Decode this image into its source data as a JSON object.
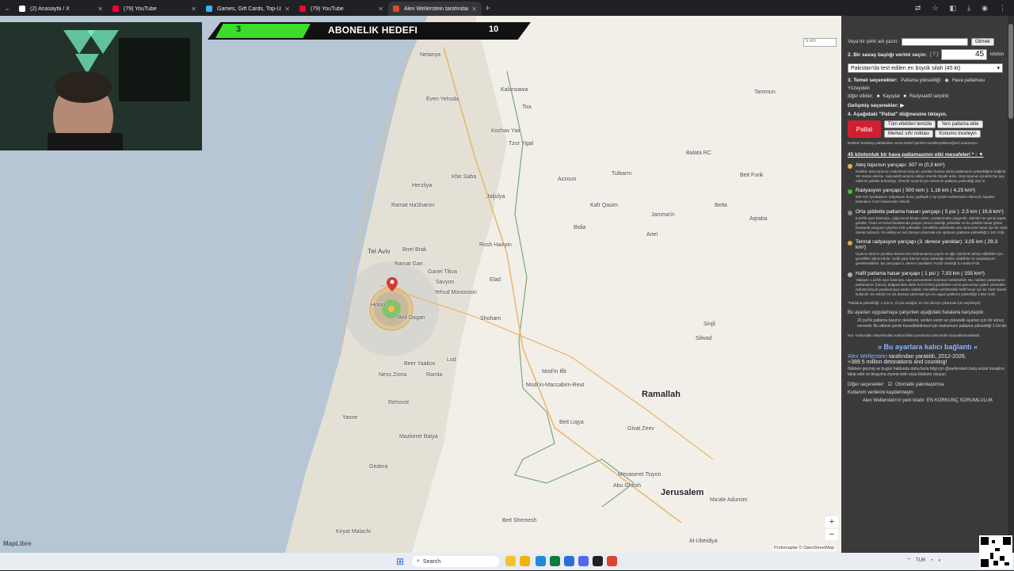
{
  "browser": {
    "tabs": [
      {
        "title": "(2) Anasayfa / X",
        "favicon_color": "#ffffff"
      },
      {
        "title": "(79) YouTube",
        "favicon_color": "#ff0033"
      },
      {
        "title": "Games, Gift Cards, Top-Ups & V",
        "favicon_color": "#3ab0ff"
      },
      {
        "title": "(79) YouTube",
        "favicon_color": "#ff0033"
      },
      {
        "title": "Alex Wellerstein tarafından hazı",
        "favicon_color": "#d94a2b"
      }
    ],
    "active_tab": 4
  },
  "overlay": {
    "current": "3",
    "label": "ABONELIK HEDEFI",
    "target": "10"
  },
  "map": {
    "scale_text": "5 km",
    "places": [
      {
        "name": "Netanya",
        "cls": ""
      },
      {
        "name": "Kalansawa",
        "cls": ""
      },
      {
        "name": "Even Yehuda",
        "cls": ""
      },
      {
        "name": "Tira",
        "cls": ""
      },
      {
        "name": "Kochav Yair",
        "cls": ""
      },
      {
        "name": "Tzur Yigal",
        "cls": ""
      },
      {
        "name": "Tulkarm",
        "cls": ""
      },
      {
        "name": "Tammun",
        "cls": ""
      },
      {
        "name": "Kfar Saba",
        "cls": ""
      },
      {
        "name": "Herzliya",
        "cls": ""
      },
      {
        "name": "Ramat HaSharon",
        "cls": ""
      },
      {
        "name": "Jaljulya",
        "cls": ""
      },
      {
        "name": "Azzoun",
        "cls": ""
      },
      {
        "name": "Balata RC",
        "cls": ""
      },
      {
        "name": "Beit Furik",
        "cls": ""
      },
      {
        "name": "Kafr Qasim",
        "cls": ""
      },
      {
        "name": "Beita",
        "cls": ""
      },
      {
        "name": "Jamma'in",
        "cls": ""
      },
      {
        "name": "Aqraba",
        "cls": ""
      },
      {
        "name": "Bidia",
        "cls": ""
      },
      {
        "name": "Ariel",
        "cls": ""
      },
      {
        "name": "Rosh HaAyin",
        "cls": ""
      },
      {
        "name": "Tel Aviv",
        "cls": "med"
      },
      {
        "name": "Bnei Brak",
        "cls": ""
      },
      {
        "name": "Ramat Gan",
        "cls": ""
      },
      {
        "name": "Ganei Tikva",
        "cls": ""
      },
      {
        "name": "Savyon",
        "cls": ""
      },
      {
        "name": "Yehud Monosson",
        "cls": ""
      },
      {
        "name": "Elad",
        "cls": ""
      },
      {
        "name": "Holon",
        "cls": ""
      },
      {
        "name": "Beit Dagan",
        "cls": ""
      },
      {
        "name": "Shoham",
        "cls": ""
      },
      {
        "name": "Beer Yaakov",
        "cls": ""
      },
      {
        "name": "Lod",
        "cls": ""
      },
      {
        "name": "Ness Ziona",
        "cls": ""
      },
      {
        "name": "Ramla",
        "cls": ""
      },
      {
        "name": "Rehovot",
        "cls": ""
      },
      {
        "name": "Mod'in Illit",
        "cls": ""
      },
      {
        "name": "Modi'in-Maccabim-Reut",
        "cls": ""
      },
      {
        "name": "Yavne",
        "cls": ""
      },
      {
        "name": "Sinjil",
        "cls": ""
      },
      {
        "name": "Silwad",
        "cls": ""
      },
      {
        "name": "Ramallah",
        "cls": "big"
      },
      {
        "name": "Beit Liqya",
        "cls": ""
      },
      {
        "name": "Givat Zeev",
        "cls": ""
      },
      {
        "name": "Mazkeret Batya",
        "cls": ""
      },
      {
        "name": "Gedera",
        "cls": ""
      },
      {
        "name": "Jerusalem",
        "cls": "big"
      },
      {
        "name": "Ma'ale Adumim",
        "cls": ""
      },
      {
        "name": "Beit Shemesh",
        "cls": ""
      },
      {
        "name": "Kiryat Malachi",
        "cls": ""
      },
      {
        "name": "Abu Ghosh",
        "cls": ""
      },
      {
        "name": "Mevaseret Tsiyon",
        "cls": ""
      },
      {
        "name": "Al-Ubeidiya",
        "cls": ""
      }
    ],
    "attribution": "Protomaplar © OpenStreetMap",
    "brand": "MapLibre",
    "zoom_in": "+",
    "zoom_out": "−"
  },
  "panel": {
    "city_label": "Veya bir şehir adı yazın:",
    "city_button": "Gitmek",
    "step2": "2. Bir savaş başlığı verimi seçin:",
    "help": "[ ? ]",
    "yield": "45",
    "yield_unit": "kiloton",
    "preset": "Pakistan'da test edilen en büyük silah (45 kt)",
    "step3": "3. Temel seçenekler:",
    "burst_label": "Patlama yüksekliği:",
    "air_burst": "Hava patlaması",
    "surface": "Yüzeydeki",
    "other_effects": "diğer etkiler:",
    "casualties": "Kayıplar",
    "fallout": "Radyoaktif serpinti",
    "advanced": "Gelişmiş seçenekler: ▶",
    "step4": "4. Aşağıdaki \"Patlat\" düğmesine tıklayın.",
    "fire": "Patlat",
    "clear_all": "Tüm efektleri temizle",
    "new_detonation": "Yeni patlama ekle",
    "center_zero": "Merkez sıfır noktası",
    "inspect": "Konumu inceleyin",
    "note_drag": "Nükleer bombayı patlattıktan sonra hedef işaretini sürükleyebileceğinizi unutmayın.",
    "effects_header": "45 kilotonluk bir hava patlamasının etki mesafeleri * : ▼",
    "effects": [
      {
        "title": "Ateş topunun yarıçapı: 307 m (0,3 km²)",
        "color": "#e6b24a",
        "desc": "Nükleer ateş topunun maksimum boyutu; yerdeki hasara etkisi patlamanın yüksekliğine bağlıdır. Yer temas ederse, radyoaktif serpinti miktarı önemli ölçüde artar. Ateş topunun içindeki her şey etkili bir şekilde buharlaşır. Önemli serpinti için minimum patlama yüksekliği 252 m."
      },
      {
        "title": "Radyasyon yarıçapı ( 500 rem ): 1,16 km ( 4,25 km²)",
        "color": "#3fbf3f",
        "desc": "500 rem iyonlaştırıcı radyasyon dozu; yaklaşık 1 ay içinde muhtemelen ölümcül, hayatta kalanların %15'i kanserden ölecek."
      },
      {
        "title": "Orta şiddette patlama hasarı yarıçapı ( 5 psi ): 2,5 km ( 19,6 km²)",
        "color": "#8a8a8a",
        "desc": "5 psi'lik aşırı basınçta, çoğu konut binası çöker, yaralanmalar yaygındır, ölümler ise geniş çapta görülür. Ticari ve konut binalarında yangın çıkma olasılığı yüksektir ve bu şekilde hasar gören binalarda yangının yayılma riski yüksektir. Genellikle şehirlerde orta derecede hasar için bir ölçüt olarak kullanılır. En etkiliyi en üst düzeye çıkarmak için optimum patlama yüksekliği 1.110 m'dir."
      },
      {
        "title": "Termal radyasyon yarıçapı (3. derece yanıklar): 3,05 km ( 29,3 km²)",
        "color": "#e6a83a",
        "desc": "Üçüncü derece yanıklar derinin tüm katmanlarına yayılır ve ağrı sinirlerini tahrip edildikleri için genellikle ağrısızdırlar. Ciddi yara izlerine veya sakatlığa neden olabilirler ve ampütasyon gerektirebilirler. Bu yarıçapta 3. derece yanıkların %100 olasılığı 9,4 kal/cm²'dir."
      },
      {
        "title": "Hafif patlama hasar yarıçapı ( 1 psi ): 7,03 km ( 155 km²)",
        "color": "#b0b0b0",
        "desc": "Yaklaşık 1 psi'lik aşırı basınçta, cam pencerelerin kırılması beklenebilir. Bu, nükleer patlamanın parlamasını (basınç dalgasından daha hızlı ilerler) gördükten sonra pencereye giden çevredeki nüfusta birçok yaralanmaya neden olabilir. Genellikle şehirlerdeki hafif hasar için bir ölçüt olarak kullanılır. En etkiliyi en üst düzeye çıkarmak için en uygun patlama yüksekliği 1.660 m'dir."
      }
    ],
    "burst_height_note": "*Patlama yüksekliği: 1.110 m. (5 psi aralığını en üst düzeye çıkarmak için seçilmiştir)",
    "errors_header": "Bu ayarları uygulamaya çalışırken aşağıdaki hatalarla karşılaştık:",
    "error_item": "20 psi'lik patlama basıncı denklemi, verilen verim ve yükseklik ayarları için bir sonuç vermedi. Bu etkinin yerde hissedilebilmesi için maksimum patlama yüksekliği 1 km'dir.",
    "note_rounding": "Not: Yukarıdaki rakamlardaki tutarsızlıklar yuvarlama işleminden kaynaklanmaktadır.",
    "permalink": "» Bu ayarlara kalıcı bağlantı «",
    "credit_author": "Alex Wellerstein",
    "credit_rest": "tarafından yaratıldı, 2012-2026.",
    "counter": "+389.5 million detonations and counting!",
    "follow": "Nükleer geçmiş ve bugün hakkında daha fazla bilgi için @wellerstein.bsky.social hesabını takip edin ve bloguma ziyaret edin veya kitabımı okuyun.",
    "other_opts": "Diğer seçenekler:",
    "autozoom": "Otomatik yakınlaştırma",
    "keep_data": "Kullanım verilerini kaydetmeyin",
    "book": "Alex Wellerstein'ın yeni kitabı: EN KORKUNÇ SORUMLULUK"
  },
  "taskbar": {
    "search": "Search",
    "lang": "TUR"
  }
}
